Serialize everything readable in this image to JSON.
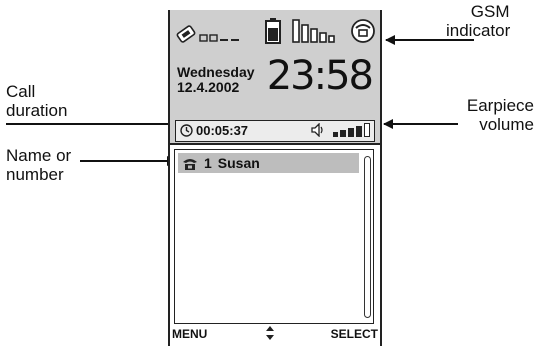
{
  "callouts": {
    "gsm_line1": "GSM",
    "gsm_line2": "indicator",
    "call_line1": "Call",
    "call_line2": "duration",
    "earpiece_line1": "Earpiece",
    "earpiece_line2": "volume",
    "name_line1": "Name or",
    "name_line2": "number"
  },
  "status": {
    "day": "Wednesday",
    "date": "12.4.2002",
    "time": "23:58",
    "icons": [
      "gsm-signal-icon",
      "battery-icon",
      "signal-strength-icon",
      "call-indicator-icon"
    ]
  },
  "call": {
    "duration": "00:05:37",
    "icons": [
      "clock-icon",
      "speaker-icon"
    ],
    "volume_level": 5,
    "volume_max": 5
  },
  "list": {
    "items": [
      {
        "index": "1",
        "name": "Susan",
        "icon": "phone-icon",
        "selected": true
      }
    ]
  },
  "softkeys": {
    "left": "MENU",
    "right": "SELECT",
    "middle_icon": "up-down-arrows-icon"
  },
  "colors": {
    "status_panel": "#cfcfcf",
    "selection": "#bdbdbd",
    "outline": "#222222"
  }
}
